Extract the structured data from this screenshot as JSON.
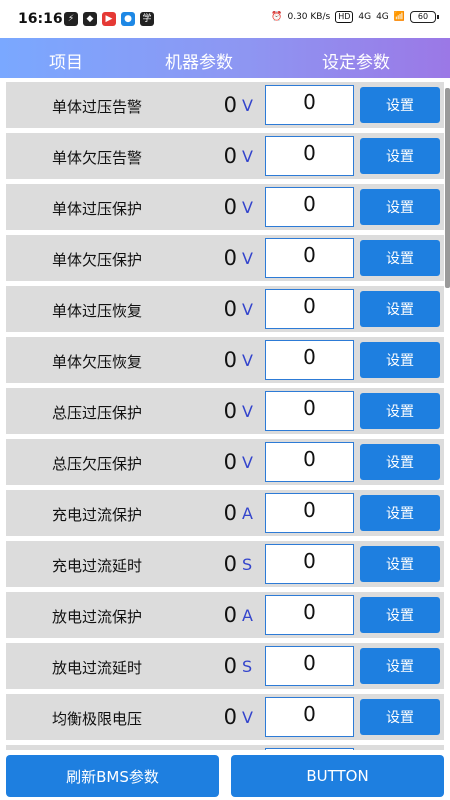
{
  "status_bar": {
    "time": "16:16",
    "speed": "0.30 KB/s",
    "hd": "HD",
    "signal1": "4G",
    "signal2": "4G",
    "battery": "60"
  },
  "header": {
    "col_item": "项目",
    "col_machine": "机器参数",
    "col_setting": "设定参数"
  },
  "rows": [
    {
      "label": "单体过压告警",
      "value": "0",
      "unit": "V",
      "input": "0",
      "button": "设置"
    },
    {
      "label": "单体欠压告警",
      "value": "0",
      "unit": "V",
      "input": "0",
      "button": "设置"
    },
    {
      "label": "单体过压保护",
      "value": "0",
      "unit": "V",
      "input": "0",
      "button": "设置"
    },
    {
      "label": "单体欠压保护",
      "value": "0",
      "unit": "V",
      "input": "0",
      "button": "设置"
    },
    {
      "label": "单体过压恢复",
      "value": "0",
      "unit": "V",
      "input": "0",
      "button": "设置"
    },
    {
      "label": "单体欠压恢复",
      "value": "0",
      "unit": "V",
      "input": "0",
      "button": "设置"
    },
    {
      "label": "总压过压保护",
      "value": "0",
      "unit": "V",
      "input": "0",
      "button": "设置"
    },
    {
      "label": "总压欠压保护",
      "value": "0",
      "unit": "V",
      "input": "0",
      "button": "设置"
    },
    {
      "label": "充电过流保护",
      "value": "0",
      "unit": "A",
      "input": "0",
      "button": "设置"
    },
    {
      "label": "充电过流延时",
      "value": "0",
      "unit": "S",
      "input": "0",
      "button": "设置"
    },
    {
      "label": "放电过流保护",
      "value": "0",
      "unit": "A",
      "input": "0",
      "button": "设置"
    },
    {
      "label": "放电过流延时",
      "value": "0",
      "unit": "S",
      "input": "0",
      "button": "设置"
    },
    {
      "label": "均衡极限电压",
      "value": "0",
      "unit": "V",
      "input": "0",
      "button": "设置"
    },
    {
      "label": "",
      "value": "",
      "unit": "",
      "input": "",
      "button": ""
    }
  ],
  "bottom": {
    "refresh_label": "刷新BMS参数",
    "button_label": "BUTTON"
  }
}
